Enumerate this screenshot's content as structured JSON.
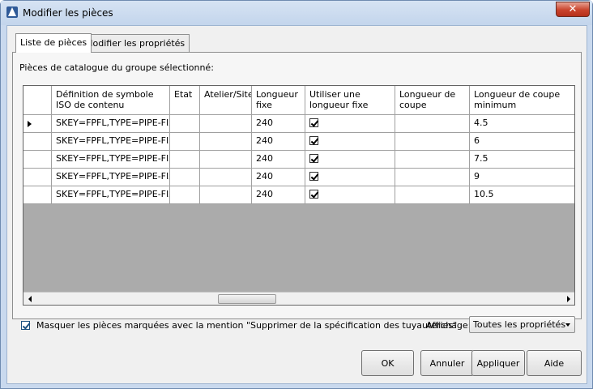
{
  "window": {
    "title": "Modifier les pièces",
    "close_label": "✕"
  },
  "tabs": [
    {
      "label": "Liste de pièces",
      "active": true
    },
    {
      "label": "Modifier les propriétés",
      "active": false
    }
  ],
  "panel": {
    "label": "Pièces de catalogue du groupe sélectionné:"
  },
  "grid": {
    "columns": [
      "Définition de symbole ISO de contenu",
      "Etat",
      "Atelier/Site",
      "Longueur fixe",
      "Utiliser une longueur fixe",
      "Longueur de coupe",
      "Longueur de coupe minimum"
    ],
    "rows": [
      {
        "iso": "SKEY=FPFL,TYPE=PIPE-FIXED",
        "etat": "",
        "atelier": "",
        "longueur_fixe": "240",
        "use_fixed": true,
        "longueur_coupe": "",
        "coupe_min": "4.5"
      },
      {
        "iso": "SKEY=FPFL,TYPE=PIPE-FIXED",
        "etat": "",
        "atelier": "",
        "longueur_fixe": "240",
        "use_fixed": true,
        "longueur_coupe": "",
        "coupe_min": "6"
      },
      {
        "iso": "SKEY=FPFL,TYPE=PIPE-FIXED",
        "etat": "",
        "atelier": "",
        "longueur_fixe": "240",
        "use_fixed": true,
        "longueur_coupe": "",
        "coupe_min": "7.5"
      },
      {
        "iso": "SKEY=FPFL,TYPE=PIPE-FIXED",
        "etat": "",
        "atelier": "",
        "longueur_fixe": "240",
        "use_fixed": true,
        "longueur_coupe": "",
        "coupe_min": "9"
      },
      {
        "iso": "SKEY=FPFL,TYPE=PIPE-FIXED",
        "etat": "",
        "atelier": "",
        "longueur_fixe": "240",
        "use_fixed": true,
        "longueur_coupe": "",
        "coupe_min": "10.5"
      }
    ]
  },
  "options": {
    "hide_label": "Masquer les pièces marquées avec la mention \"Supprimer de la spécification des tuyauteries\"",
    "hide_checked": true,
    "view_label": "Affichage:",
    "view_value": "Toutes les propriétés"
  },
  "buttons": {
    "ok": "OK",
    "cancel": "Annuler",
    "apply": "Appliquer",
    "help": "Aide"
  }
}
